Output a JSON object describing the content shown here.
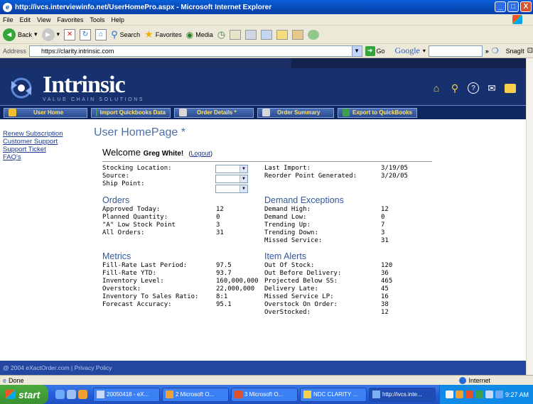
{
  "window": {
    "title": "http://ivcs.interviewinfo.net/UserHomePro.aspx - Microsoft Internet Explorer",
    "controls": [
      "_",
      "□",
      "X"
    ]
  },
  "menu": [
    "File",
    "Edit",
    "View",
    "Favorites",
    "Tools",
    "Help"
  ],
  "toolbar": {
    "back": "Back",
    "search": "Search",
    "favorites": "Favorites",
    "media": "Media"
  },
  "address": {
    "label": "Address",
    "url": "https://clarity.intrinsic.com",
    "go": "Go",
    "google": "Google",
    "snagit": "SnagIt"
  },
  "site": {
    "logo": "Intrinsic",
    "tagline": "VALUE CHAIN SOLUTIONS",
    "nav": [
      {
        "label": "User Home"
      },
      {
        "label": "Import Quickbooks Data"
      },
      {
        "label": "Order Details *"
      },
      {
        "label": "Order Summary"
      },
      {
        "label": "Export to QuickBooks"
      }
    ],
    "sidebar": [
      "Renew Subscription",
      "Customer Support",
      "Support Ticket",
      "FAQ's"
    ],
    "page_title": "User HomePage *",
    "welcome": "Welcome",
    "user": "Greg White!",
    "logout": "Logout",
    "selectors": [
      "Stocking Location:",
      "Source:",
      "Ship Point:"
    ],
    "import_info": [
      {
        "label": "Last Import:",
        "value": "3/19/05"
      },
      {
        "label": "Reorder Point Generated:",
        "value": "3/20/05"
      }
    ],
    "orders": {
      "title": "Orders",
      "rows": [
        {
          "label": "Approved Today:",
          "value": "12"
        },
        {
          "label": "Planned Quantity:",
          "value": "0"
        },
        {
          "label": "\"A\" Low Stock Point",
          "value": "3"
        },
        {
          "label": "All Orders:",
          "value": "31"
        }
      ]
    },
    "demand": {
      "title": "Demand Exceptions",
      "rows": [
        {
          "label": "Demand High:",
          "value": "12"
        },
        {
          "label": "Demand Low:",
          "value": "0"
        },
        {
          "label": "Trending Up:",
          "value": "7"
        },
        {
          "label": "Trending Down:",
          "value": "3"
        },
        {
          "label": "Missed Service:",
          "value": "31"
        }
      ]
    },
    "metrics": {
      "title": "Metrics",
      "rows": [
        {
          "label": "Fill-Rate Last Period:",
          "value": "97.5"
        },
        {
          "label": "Fill-Rate YTD:",
          "value": "93.7"
        },
        {
          "label": "Inventory Level:",
          "value": "160,000,000"
        },
        {
          "label": "Overstock:",
          "value": "22,000,000"
        },
        {
          "label": "Inventory To Sales Ratio:",
          "value": "8:1"
        },
        {
          "label": "Forecast Accuracy:",
          "value": "95.1"
        }
      ]
    },
    "alerts": {
      "title": "Item Alerts",
      "rows": [
        {
          "label": "Out Of Stock:",
          "value": "120"
        },
        {
          "label": "Out Before Delivery:",
          "value": "36"
        },
        {
          "label": "Projected Below SS:",
          "value": "465"
        },
        {
          "label": "Delivery Late:",
          "value": "45"
        },
        {
          "label": "Missed Service LP:",
          "value": "16"
        },
        {
          "label": "Overstock On Order:",
          "value": "38"
        },
        {
          "label": "OverStocked:",
          "value": "12"
        }
      ]
    },
    "footer": "@ 2004 eXactOrder.com | Privacy Policy"
  },
  "status": {
    "text": "Done",
    "zone": "Internet"
  },
  "taskbar": {
    "start": "start",
    "tasks": [
      "20050418 - eX...",
      "2 Microsoft O...",
      "3 Microsoft O...",
      "NDC CLARITY ...",
      "http://ivcs.inte..."
    ],
    "clock": "9:27 AM"
  },
  "colors": {
    "header": "#17316e",
    "nav": "#0f2761",
    "title": "#4d6ea8",
    "link": "#1b3a8f",
    "footer": "#2346a0"
  }
}
